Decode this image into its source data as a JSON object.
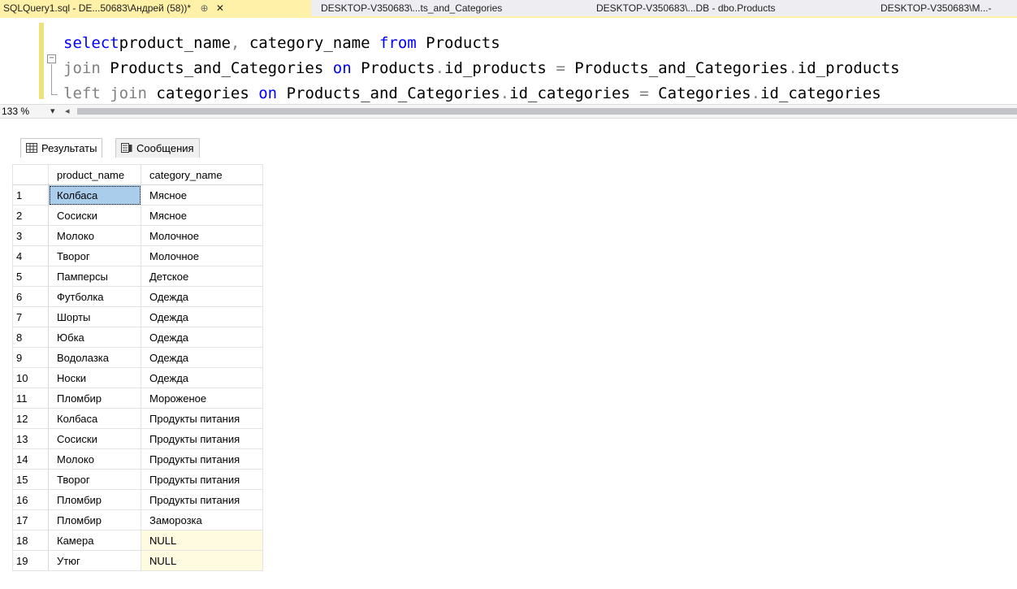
{
  "tabs": [
    {
      "label": "SQLQuery1.sql - DE...50683\\Андрей (58))*",
      "pin": "⊕",
      "close": "✕"
    },
    {
      "label": "DESKTOP-V350683\\...ts_and_Categories"
    },
    {
      "label": "DESKTOP-V350683\\...DB - dbo.Products"
    },
    {
      "label": "DESKTOP-V350683\\M...-"
    }
  ],
  "editor": {
    "lines": [
      {
        "parts": [
          [
            "kw",
            "select"
          ],
          [
            "",
            "product_name"
          ],
          [
            "op",
            ","
          ],
          [
            "",
            " category_name "
          ],
          [
            "kw",
            "from"
          ],
          [
            "",
            " Products"
          ]
        ]
      },
      {
        "parts": [
          [
            "op",
            "join"
          ],
          [
            "",
            " Products_and_Categories "
          ],
          [
            "kw",
            "on"
          ],
          [
            "",
            " Products"
          ],
          [
            "op",
            "."
          ],
          [
            "",
            "id_products "
          ],
          [
            "op",
            "="
          ],
          [
            "",
            " Products_and_Categories"
          ],
          [
            "op",
            "."
          ],
          [
            "",
            "id_products"
          ]
        ]
      },
      {
        "parts": [
          [
            "op",
            "left join"
          ],
          [
            "",
            " categories "
          ],
          [
            "kw",
            "on"
          ],
          [
            "",
            " Products_and_Categories"
          ],
          [
            "op",
            "."
          ],
          [
            "",
            "id_categories "
          ],
          [
            "op",
            "="
          ],
          [
            "",
            " Categories"
          ],
          [
            "op",
            "."
          ],
          [
            "",
            "id_categories"
          ]
        ]
      }
    ]
  },
  "zoom": {
    "label": "133 %"
  },
  "results": {
    "tab_results": "Результаты",
    "tab_messages": "Сообщения",
    "columns": [
      "product_name",
      "category_name"
    ],
    "rows": [
      [
        "1",
        "Колбаса",
        "Мясное"
      ],
      [
        "2",
        "Сосиски",
        "Мясное"
      ],
      [
        "3",
        "Молоко",
        "Молочное"
      ],
      [
        "4",
        "Творог",
        "Молочное"
      ],
      [
        "5",
        "Памперсы",
        "Детское"
      ],
      [
        "6",
        "Футболка",
        "Одежда"
      ],
      [
        "7",
        "Шорты",
        "Одежда"
      ],
      [
        "8",
        "Юбка",
        "Одежда"
      ],
      [
        "9",
        "Водолазка",
        "Одежда"
      ],
      [
        "10",
        "Носки",
        "Одежда"
      ],
      [
        "11",
        "Пломбир",
        "Мороженое"
      ],
      [
        "12",
        "Колбаса",
        "Продукты питания"
      ],
      [
        "13",
        "Сосиски",
        "Продукты питания"
      ],
      [
        "14",
        "Молоко",
        "Продукты питания"
      ],
      [
        "15",
        "Творог",
        "Продукты питания"
      ],
      [
        "16",
        "Пломбир",
        "Продукты питания"
      ],
      [
        "17",
        "Пломбир",
        "Заморозка"
      ],
      [
        "18",
        "Камера",
        "NULL"
      ],
      [
        "19",
        "Утюг",
        "NULL"
      ]
    ]
  },
  "colors": {
    "keyword": "#0000ff",
    "operator": "#808080",
    "active_tab": "#fff1a8",
    "selected_cell": "#a9cdeb",
    "null_cell": "#fffbe0"
  }
}
